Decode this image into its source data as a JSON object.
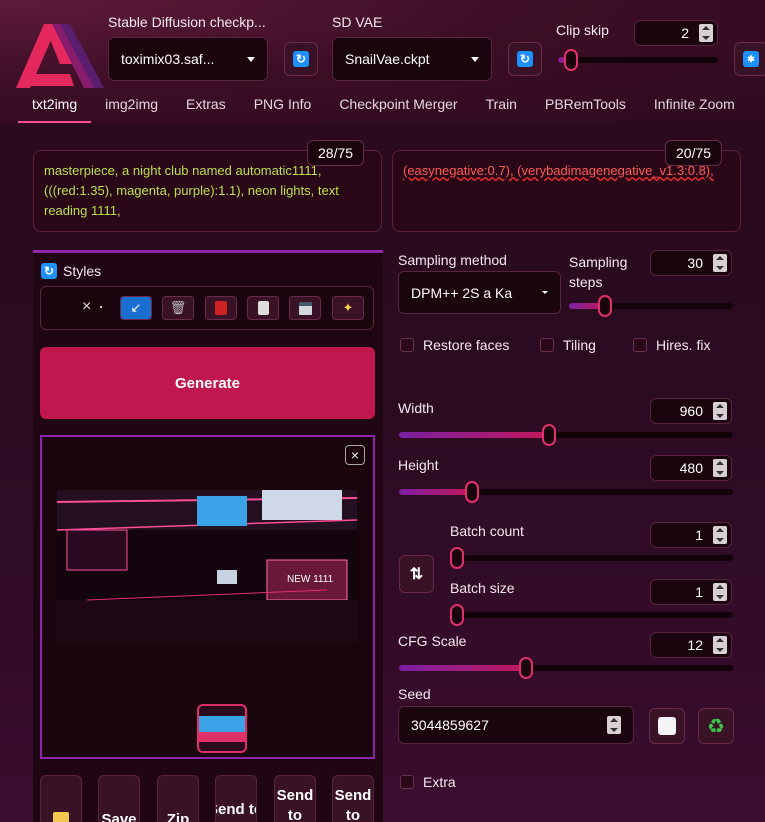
{
  "header": {
    "checkpoint_label": "Stable Diffusion checkp...",
    "checkpoint_value": "toximix03.saf...",
    "vae_label": "SD VAE",
    "vae_value": "SnailVae.ckpt",
    "clip_skip_label": "Clip skip",
    "clip_skip_value": "2",
    "clip_skip_fraction": 0.08
  },
  "tabs": [
    "txt2img",
    "img2img",
    "Extras",
    "PNG Info",
    "Checkpoint Merger",
    "Train",
    "PBRemTools",
    "Infinite Zoom"
  ],
  "prompt": {
    "positive_text": "masterpiece, a night club named automatic1111, (((red:1.35), magenta, purple):1.1), neon lights, text reading 1111,",
    "positive_tokens": "28/75",
    "negative_text": "(easynegative:0.7), (verybadimagenegative_v1.3:0.8),",
    "negative_tokens": "20/75"
  },
  "styles": {
    "label": "Styles",
    "clear": "×"
  },
  "generate_label": "Generate",
  "sampling": {
    "method_label": "Sampling method",
    "method_value": "DPM++ 2S a Ka",
    "steps_label": "Sampling steps",
    "steps_value": "30",
    "steps_fraction": 0.22
  },
  "checkboxes": {
    "restore_faces": "Restore faces",
    "tiling": "Tiling",
    "hires_fix": "Hires. fix",
    "extra": "Extra"
  },
  "width": {
    "label": "Width",
    "value": "960",
    "fraction": 0.45
  },
  "height": {
    "label": "Height",
    "value": "480",
    "fraction": 0.22
  },
  "batch_count": {
    "label": "Batch count",
    "value": "1",
    "fraction": 0.0
  },
  "batch_size": {
    "label": "Batch size",
    "value": "1",
    "fraction": 0.0
  },
  "cfg": {
    "label": "CFG Scale",
    "value": "12",
    "fraction": 0.38
  },
  "seed": {
    "label": "Seed",
    "value": "3044859627"
  },
  "image_caption": "NEW 1111",
  "bottom_buttons": [
    "",
    "Save",
    "Zip",
    "Send to",
    "Send to",
    "Send to"
  ],
  "colors": {
    "accent": "#c2185b",
    "generate": "#c0184e",
    "panel_border": "#8e24aa"
  }
}
